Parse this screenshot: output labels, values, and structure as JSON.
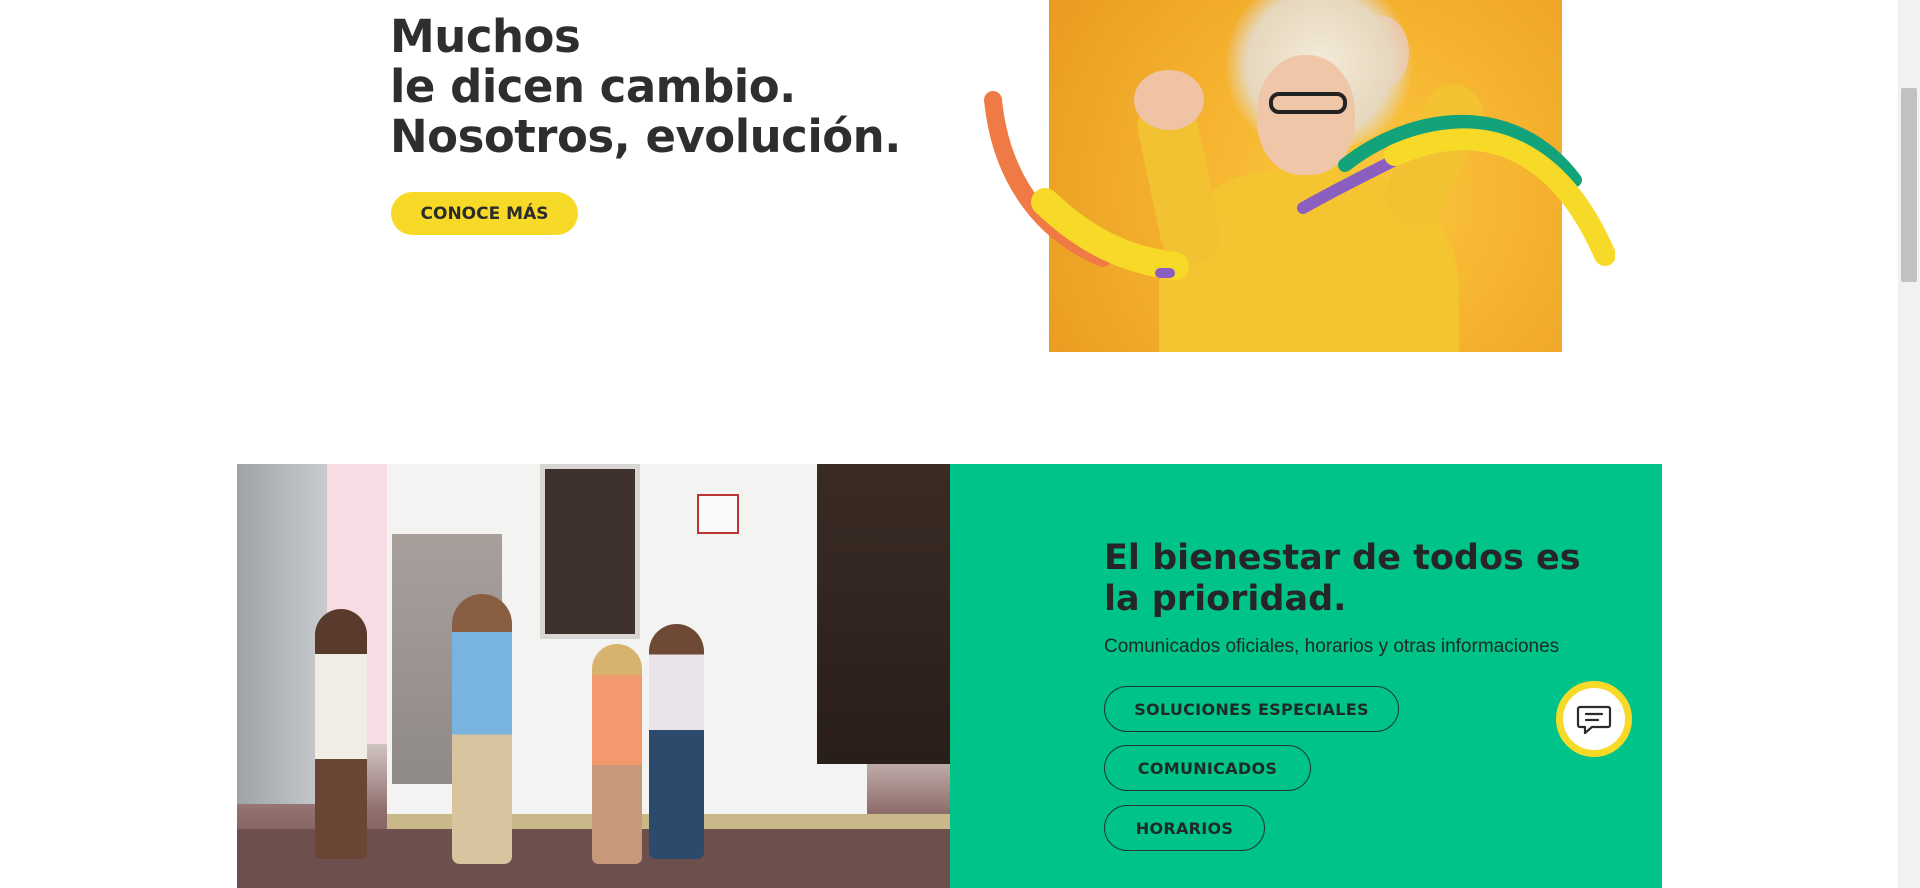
{
  "hero": {
    "title_lines": [
      "Muchos",
      "le dicen cambio.",
      "Nosotros, evolución."
    ],
    "cta_label": "CONOCE MÁS"
  },
  "wellbeing": {
    "title": "El bienestar de todos es la prioridad.",
    "subtitle": "Comunicados oficiales, horarios y otras informaciones",
    "buttons": [
      "SOLUCIONES ESPECIALES",
      "COMUNICADOS",
      "HORARIOS"
    ]
  },
  "chat": {
    "icon": "chat-bubble-icon"
  },
  "colors": {
    "brand_yellow": "#f7d928",
    "brand_green": "#00c389",
    "ribbon_orange": "#f07a45",
    "ribbon_purple": "#8b5fbf",
    "ribbon_teal": "#12a37a",
    "text_dark": "#2e2e2e"
  }
}
